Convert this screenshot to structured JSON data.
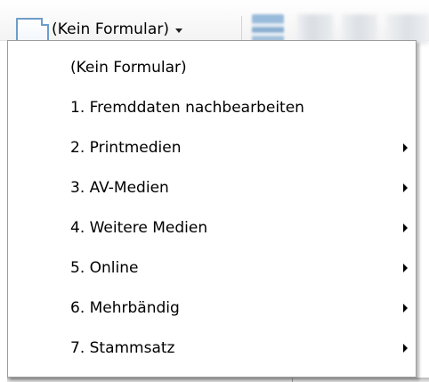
{
  "toolbar": {
    "form_selector": {
      "icon": "document-icon",
      "label": "(Kein Formular)",
      "caret_icon": "dropdown-caret-icon"
    },
    "buttons": [
      {
        "icon": "layout-icon"
      },
      {
        "icon": "toolbar-icon"
      },
      {
        "icon": "toolbar-icon"
      },
      {
        "icon": "toolbar-icon"
      }
    ]
  },
  "menu": {
    "items": [
      {
        "label": "(Kein Formular)",
        "has_submenu": false
      },
      {
        "label": "1. Fremddaten nachbearbeiten",
        "has_submenu": false
      },
      {
        "label": "2. Printmedien",
        "has_submenu": true
      },
      {
        "label": "3. AV-Medien",
        "has_submenu": true
      },
      {
        "label": "4. Weitere Medien",
        "has_submenu": true
      },
      {
        "label": "5. Online",
        "has_submenu": true
      },
      {
        "label": "6. Mehrbändig",
        "has_submenu": true
      },
      {
        "label": "7. Stammsatz",
        "has_submenu": true
      }
    ]
  },
  "colors": {
    "icon_border": "#6e9dc9",
    "menu_border": "#9c9c9c",
    "text": "#000000"
  }
}
